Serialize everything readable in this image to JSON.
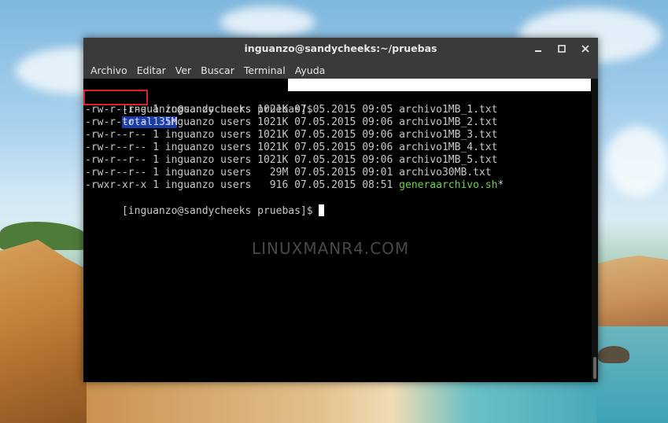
{
  "window": {
    "title": "inguanzo@sandycheeks:~/pruebas"
  },
  "menu": [
    "Archivo",
    "Editar",
    "Ver",
    "Buscar",
    "Terminal",
    "Ayuda"
  ],
  "terminal": {
    "prompt1": "[inguanzo@sandycheeks pruebas]$",
    "command": " ls -hl",
    "total": "total 35M",
    "rows": [
      {
        "text": "-rw-r--r-- 1 inguanzo users 1021K 07.05.2015 09:05 ",
        "name": "archivo1MB_1.txt",
        "suffix": ""
      },
      {
        "text": "-rw-r--r-- 1 inguanzo users 1021K 07.05.2015 09:06 ",
        "name": "archivo1MB_2.txt",
        "suffix": ""
      },
      {
        "text": "-rw-r--r-- 1 inguanzo users 1021K 07.05.2015 09:06 ",
        "name": "archivo1MB_3.txt",
        "suffix": ""
      },
      {
        "text": "-rw-r--r-- 1 inguanzo users 1021K 07.05.2015 09:06 ",
        "name": "archivo1MB_4.txt",
        "suffix": ""
      },
      {
        "text": "-rw-r--r-- 1 inguanzo users 1021K 07.05.2015 09:06 ",
        "name": "archivo1MB_5.txt",
        "suffix": ""
      },
      {
        "text": "-rw-r--r-- 1 inguanzo users   29M 07.05.2015 09:01 ",
        "name": "archivo30MB.txt",
        "suffix": ""
      },
      {
        "text": "-rwxr-xr-x 1 inguanzo users   916 07.05.2015 08:51 ",
        "name": "generaarchivo.sh",
        "suffix": "*"
      }
    ],
    "prompt2": "[inguanzo@sandycheeks pruebas]$ "
  },
  "watermark": "LINUXMANR4.COM",
  "colors": {
    "exec_green": "#6ed34a",
    "highlight_red": "#d9232b",
    "selection_blue": "#1a3ea6"
  }
}
